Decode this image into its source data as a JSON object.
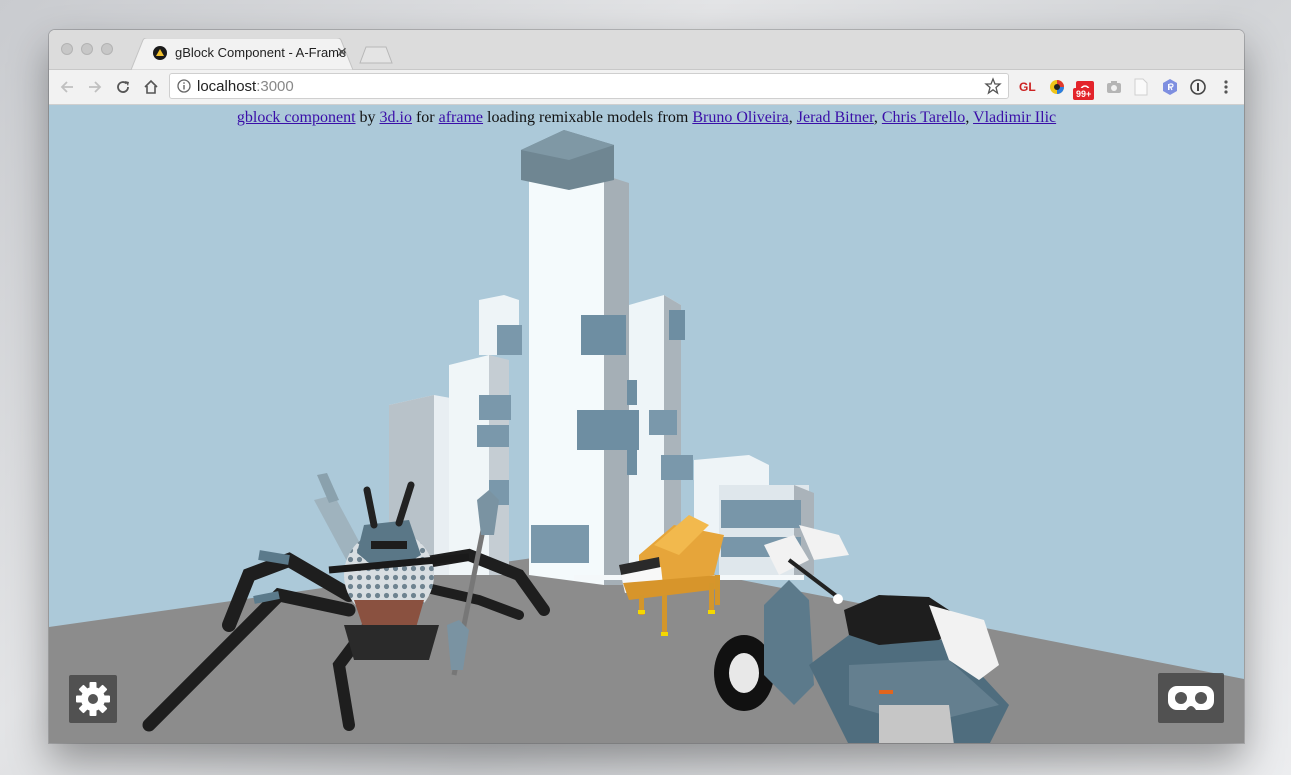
{
  "browser": {
    "tab": {
      "title": "gBlock Component - A-Frame",
      "close_label": "✕"
    },
    "address": {
      "host": "localhost",
      "port": ":3000"
    },
    "extensions": {
      "gl_label": "GL",
      "badge_count": "99+"
    }
  },
  "page": {
    "credits": {
      "link_gblock": "gblock component",
      "text_by": " by ",
      "link_3dio": "3d.io",
      "text_for": " for ",
      "link_aframe": "aframe",
      "text_loading": " loading remixable models from ",
      "author_1": "Bruno Oliveira",
      "author_2": "Jerad Bitner",
      "author_3": "Chris Tarello",
      "author_4": "Vladimir Ilic",
      "comma": ", "
    },
    "scene": {
      "sky_color": "#acc9d9",
      "ground_color": "#8c8c8c",
      "models": [
        "castle",
        "spider",
        "piano",
        "scooter"
      ]
    },
    "controls": {
      "settings_icon": "gear-icon",
      "vr_icon": "vr-headset-icon"
    }
  }
}
